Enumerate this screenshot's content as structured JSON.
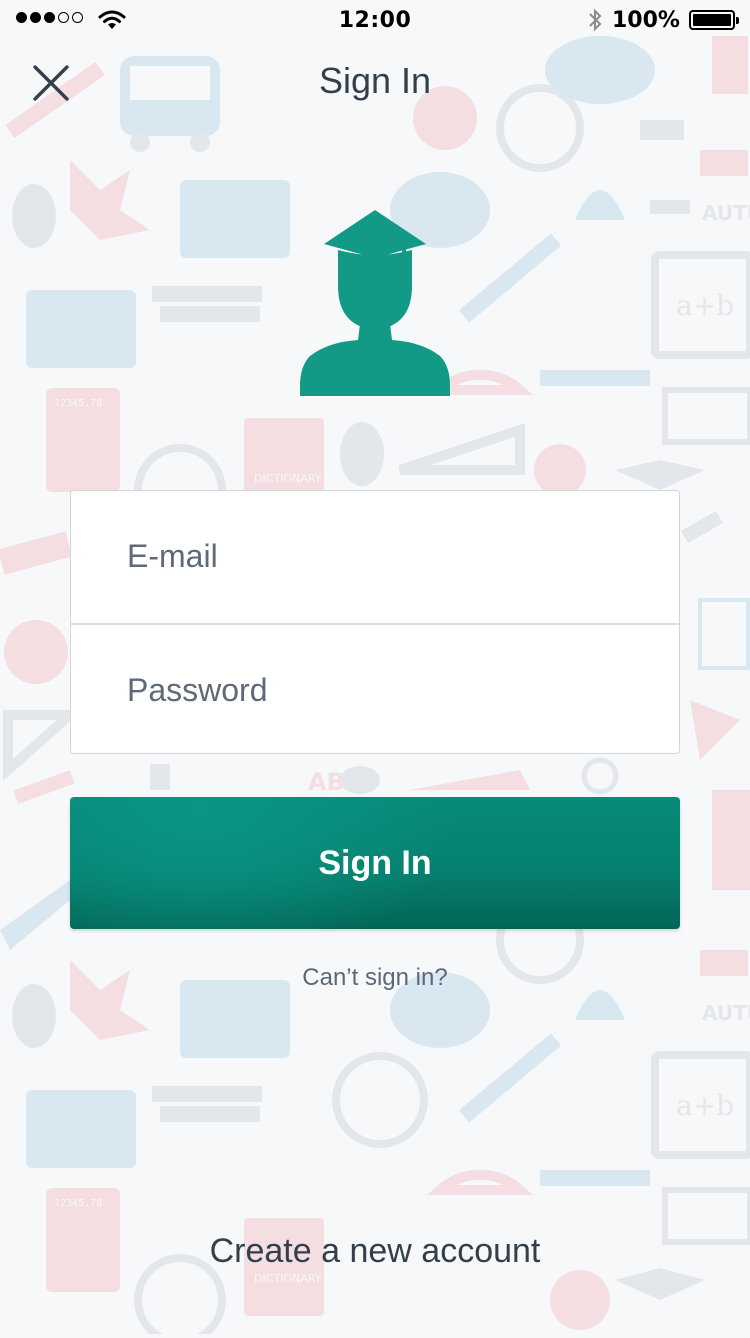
{
  "status_bar": {
    "signal_dots_filled": 3,
    "signal_dots_total": 5,
    "time": "12:00",
    "battery_percent_text": "100%",
    "battery_level": 1.0,
    "icons": [
      "signal-dots-icon",
      "wifi-icon",
      "bluetooth-icon",
      "battery-icon"
    ]
  },
  "nav": {
    "title": "Sign In",
    "close_icon": "close-icon"
  },
  "avatar": {
    "icon": "graduate-user-icon",
    "color": "#129a87"
  },
  "form": {
    "email_placeholder": "E-mail",
    "email_value": "",
    "password_placeholder": "Password",
    "password_value": ""
  },
  "actions": {
    "sign_in_label": "Sign In",
    "cant_sign_in_label": "Can’t sign in?",
    "create_account_label": "Create a new account"
  },
  "background": {
    "pattern": "school-supplies-doodles",
    "doodle_labels": [
      "AUTU",
      "a+b",
      "DICTIONARY",
      "12345.78",
      "AB"
    ],
    "colors": {
      "blue": "#cfe2ee",
      "red": "#f4d6d8",
      "gray": "#dde2e6"
    }
  },
  "colors": {
    "accent": "#0a8a78",
    "text_dark": "#33404c",
    "text_muted": "#5d6876"
  }
}
